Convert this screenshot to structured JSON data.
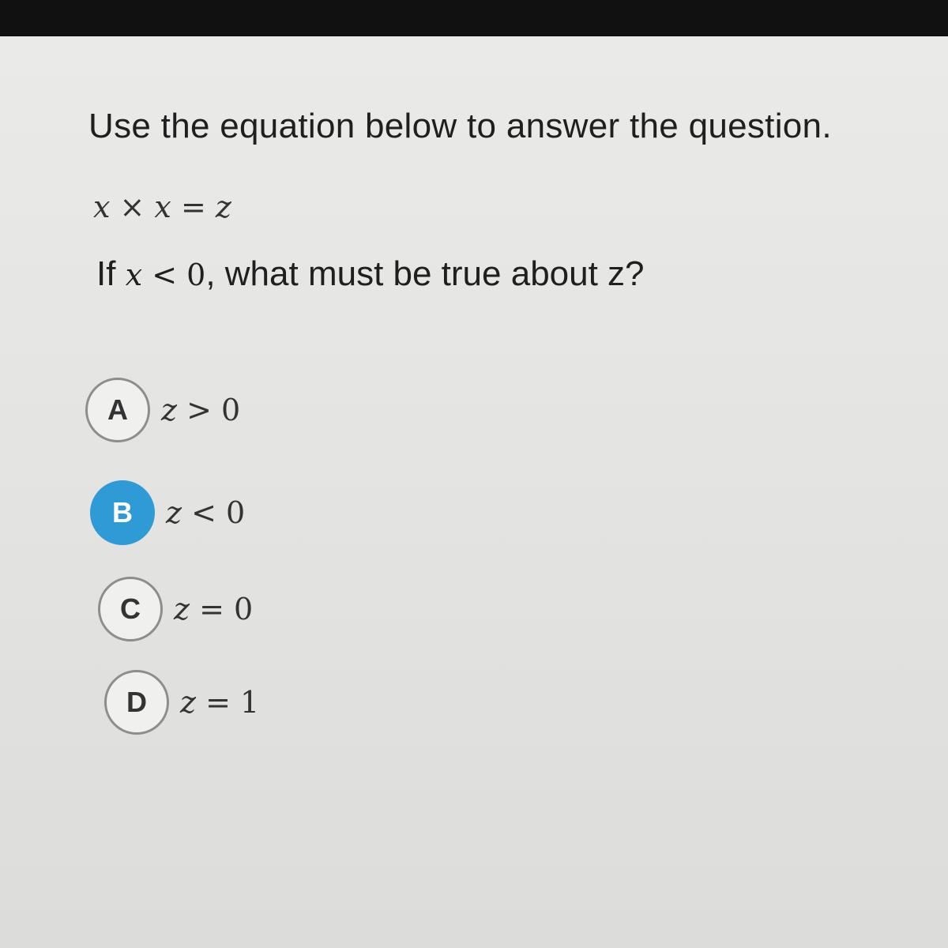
{
  "question": {
    "prompt": "Use the equation below to answer the question.",
    "equation": "x × x = z",
    "condition_prefix": "If",
    "condition_var": "x",
    "condition_rest": "< 0",
    "condition_suffix": ", what must be true about z?"
  },
  "choices": [
    {
      "letter": "A",
      "var": "z",
      "rest": "> 0",
      "selected": false
    },
    {
      "letter": "B",
      "var": "z",
      "rest": "< 0",
      "selected": true
    },
    {
      "letter": "C",
      "var": "z",
      "rest": "= 0",
      "selected": false
    },
    {
      "letter": "D",
      "var": "z",
      "rest": "= 1",
      "selected": false
    }
  ],
  "colors": {
    "selected": "#2e9bd6",
    "background": "#e4e4e2"
  }
}
